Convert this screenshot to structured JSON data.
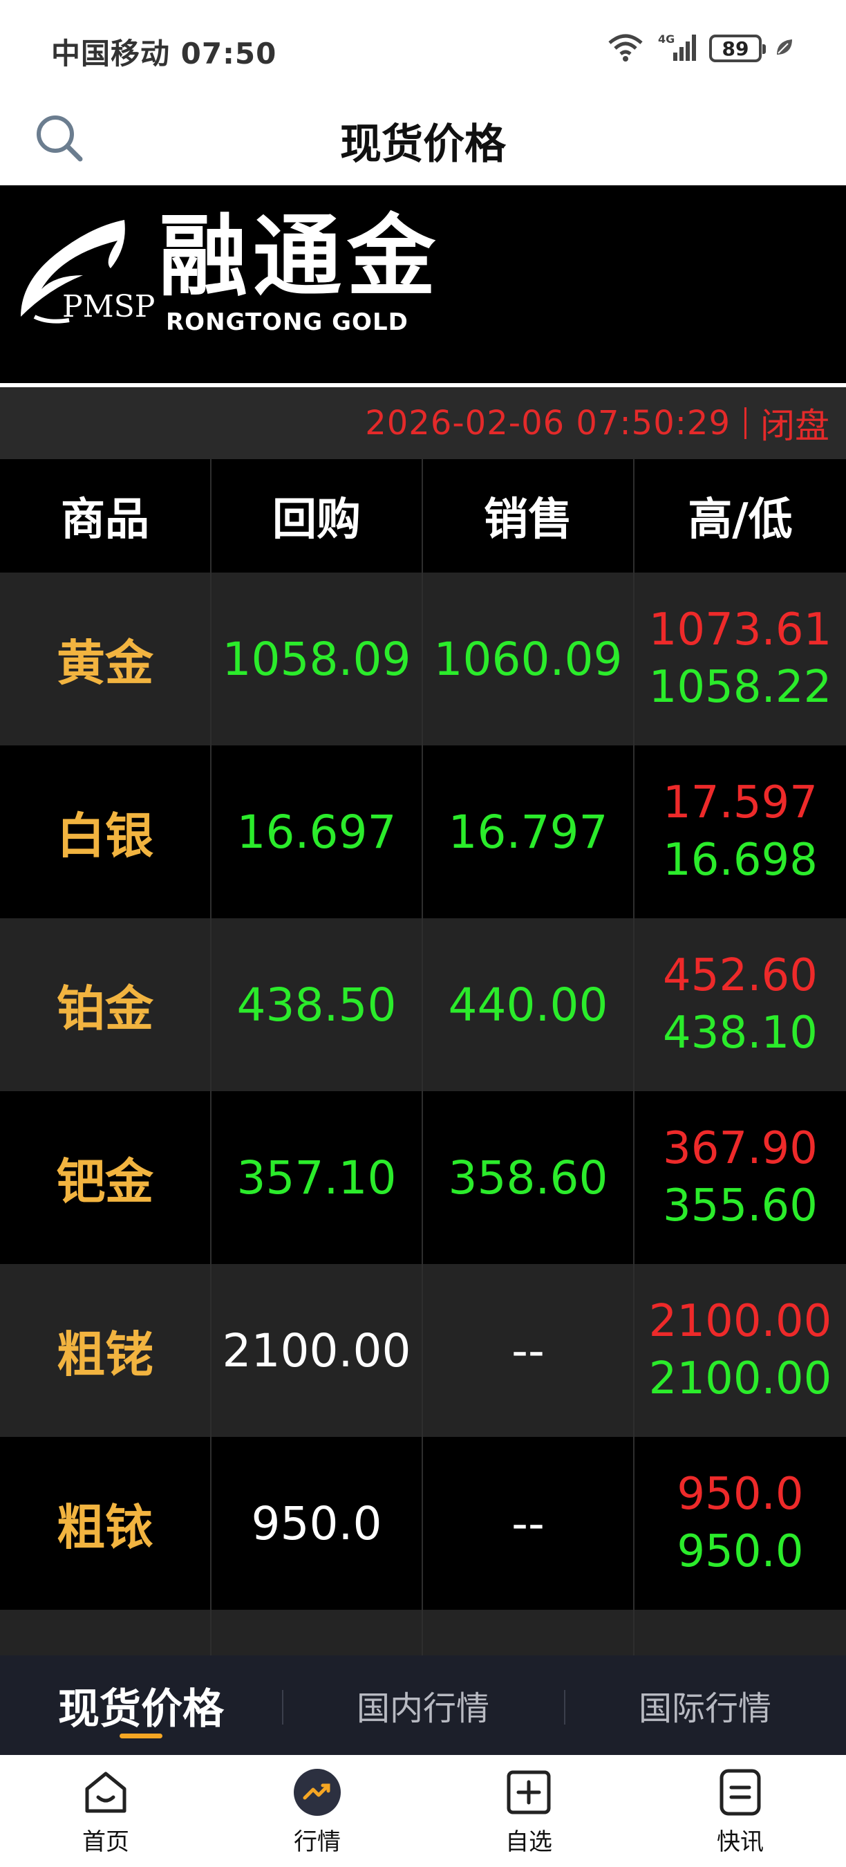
{
  "status_bar": {
    "carrier": "中国移动",
    "time": "07:50",
    "battery": "89"
  },
  "header": {
    "title": "现货价格",
    "search_icon": "search-icon"
  },
  "banner": {
    "brand_cn": "融通金",
    "brand_en": "RONGTONG  GOLD",
    "brand_abbr": "PMSP"
  },
  "market": {
    "timestamp": "2026-02-06 07:50:29",
    "state": "闭盘"
  },
  "table": {
    "headers": [
      "商品",
      "回购",
      "销售",
      "高/低"
    ],
    "rows": [
      {
        "name": "黄金",
        "buyback": "1058.09",
        "sell": "1060.09",
        "high": "1073.61",
        "low": "1058.22"
      },
      {
        "name": "白银",
        "buyback": "16.697",
        "sell": "16.797",
        "high": "17.597",
        "low": "16.698"
      },
      {
        "name": "铂金",
        "buyback": "438.50",
        "sell": "440.00",
        "high": "452.60",
        "low": "438.10"
      },
      {
        "name": "钯金",
        "buyback": "357.10",
        "sell": "358.60",
        "high": "367.90",
        "low": "355.60"
      },
      {
        "name": "粗铑",
        "buyback": "2100.00",
        "sell": "--",
        "high": "2100.00",
        "low": "2100.00"
      },
      {
        "name": "粗铱",
        "buyback": "950.0",
        "sell": "--",
        "high": "950.0",
        "low": "950.0"
      }
    ]
  },
  "sub_tabs": [
    {
      "label": "现货价格",
      "active": true
    },
    {
      "label": "国内行情",
      "active": false
    },
    {
      "label": "国际行情",
      "active": false
    }
  ],
  "bottom_nav": [
    {
      "label": "首页",
      "icon": "home-icon"
    },
    {
      "label": "行情",
      "icon": "market-icon"
    },
    {
      "label": "自选",
      "icon": "add-watchlist-icon"
    },
    {
      "label": "快讯",
      "icon": "news-icon"
    }
  ],
  "colors": {
    "up": "#ee2a2a",
    "down": "#2bec2b",
    "product": "#f2b440",
    "accent": "#f5a623"
  }
}
